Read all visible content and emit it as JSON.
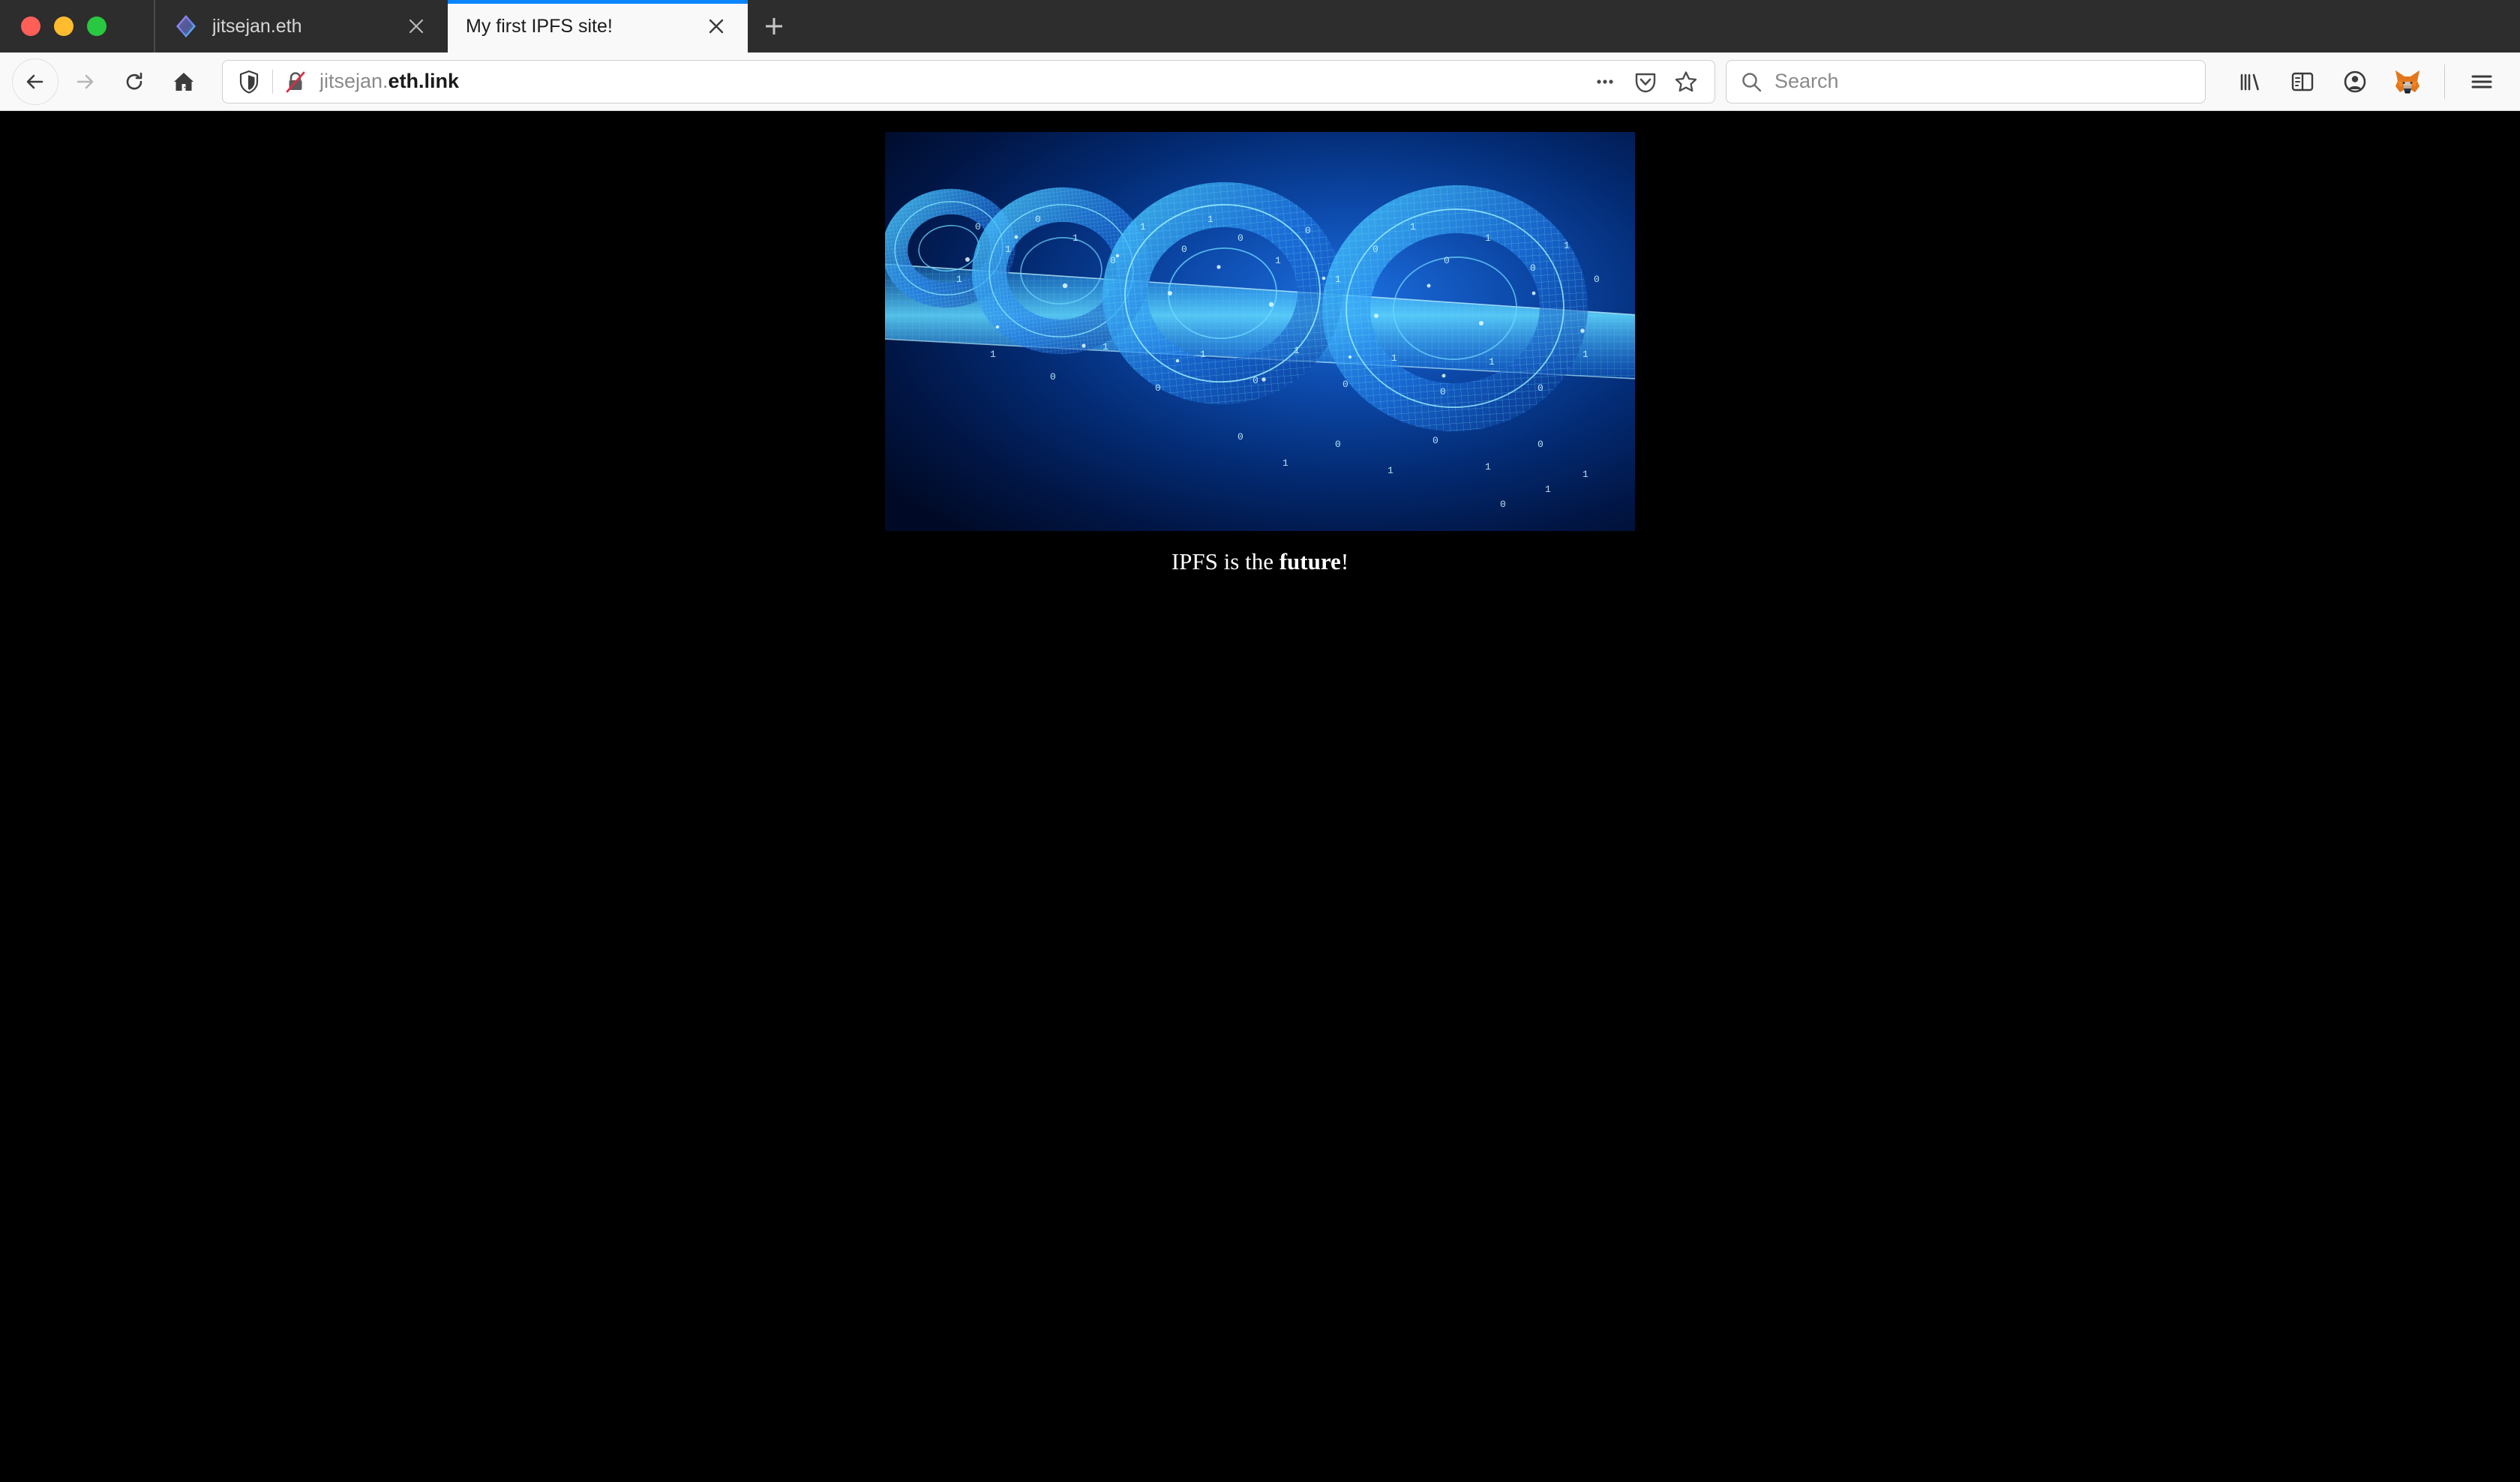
{
  "window": {
    "traffic_lights": [
      {
        "name": "close",
        "color": "#ff5f57"
      },
      {
        "name": "minimize",
        "color": "#febc2e"
      },
      {
        "name": "zoom",
        "color": "#28c840"
      }
    ]
  },
  "tabs": [
    {
      "title": "jitsejan.eth",
      "active": false,
      "favicon": "ethereum-diamond-icon",
      "close_label": "✕"
    },
    {
      "title": "My first IPFS site!",
      "active": true,
      "favicon": "",
      "close_label": "✕"
    }
  ],
  "newtab": {
    "label": "+",
    "tooltip": "Open a new tab"
  },
  "navigation": {
    "back_label": "Back",
    "forward_label": "Forward",
    "reload_label": "Reload",
    "home_label": "Home"
  },
  "urlbar": {
    "url_prefix": "jitsejan.",
    "url_domain": "eth.link",
    "shield_label": "Enhanced Tracking Protection",
    "lock_label": "Connection is not secure",
    "page_actions_label": "•••",
    "pocket_label": "Save to Pocket",
    "bookmark_label": "Bookmark this page"
  },
  "search": {
    "placeholder": "Search",
    "value": ""
  },
  "toolbar_right": {
    "library_label": "Library",
    "sidebar_label": "Sidebar",
    "account_label": "Account",
    "extension_label": "MetaMask",
    "menu_label": "Open application menu"
  },
  "page": {
    "background": "#000000",
    "hero_alt": "blockchain-chain-links-wireframe",
    "caption_prefix": "IPFS is the ",
    "caption_strong": "future",
    "caption_suffix": "!"
  },
  "colors": {
    "accent_blue": "#0a84ff",
    "chrome_dark": "#2d2d2d",
    "chrome_light": "#f9f9fa",
    "page_black": "#000000",
    "hero_blue_deep": "#01164a",
    "hero_blue_bright": "#1761d8",
    "hero_cyan": "#35d6ff",
    "metamask_orange": "#e2761b"
  }
}
